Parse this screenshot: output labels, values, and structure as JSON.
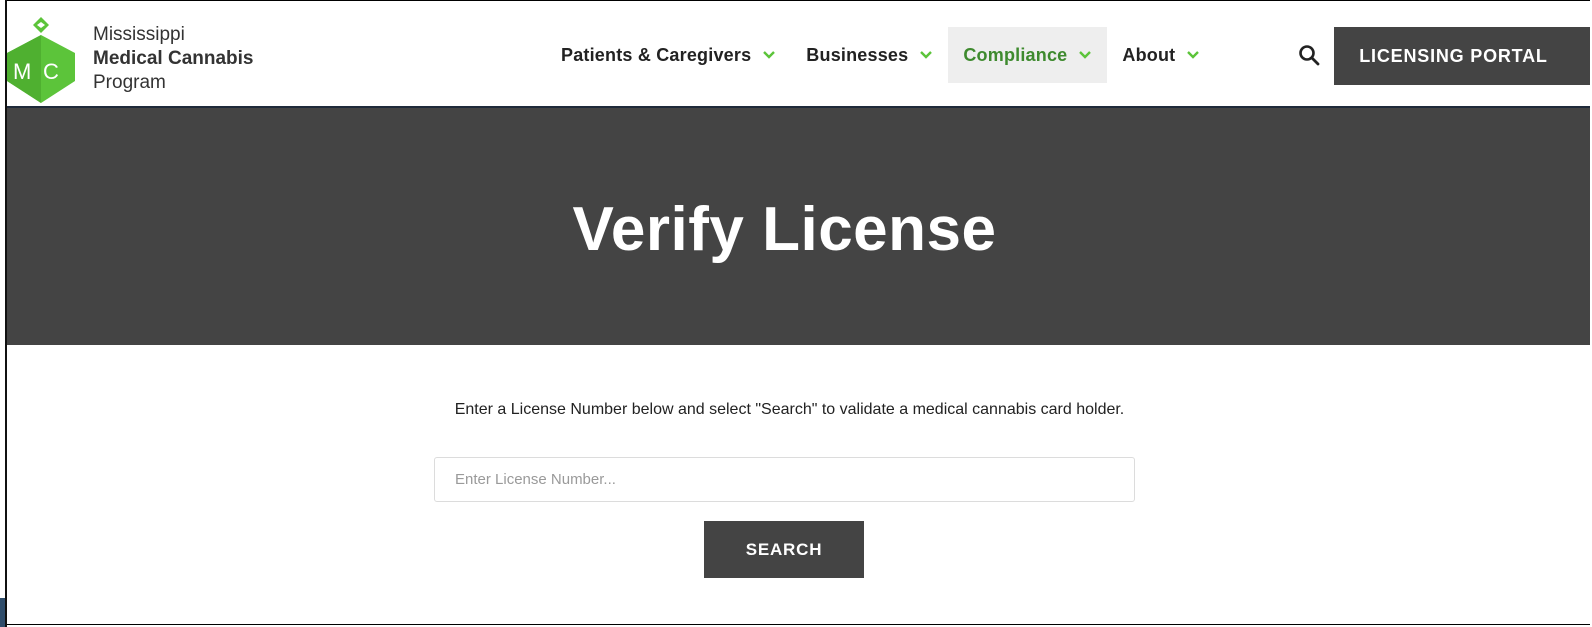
{
  "brand": {
    "line1": "Mississippi",
    "line2": "Medical Cannabis",
    "line3": "Program",
    "logo_letters": [
      "M",
      "C"
    ],
    "logo_color": "#5cc43a"
  },
  "nav": {
    "items": [
      {
        "label": "Patients & Caregivers",
        "active": false
      },
      {
        "label": "Businesses",
        "active": false
      },
      {
        "label": "Compliance",
        "active": true
      },
      {
        "label": "About",
        "active": false
      }
    ],
    "portal_label": "LICENSING PORTAL",
    "accent_color": "#5cc43a"
  },
  "hero": {
    "title": "Verify License"
  },
  "content": {
    "instruction": "Enter a License Number below and select \"Search\" to validate a medical cannabis card holder.",
    "input": {
      "placeholder": "Enter License Number...",
      "value": ""
    },
    "search_label": "SEARCH"
  }
}
